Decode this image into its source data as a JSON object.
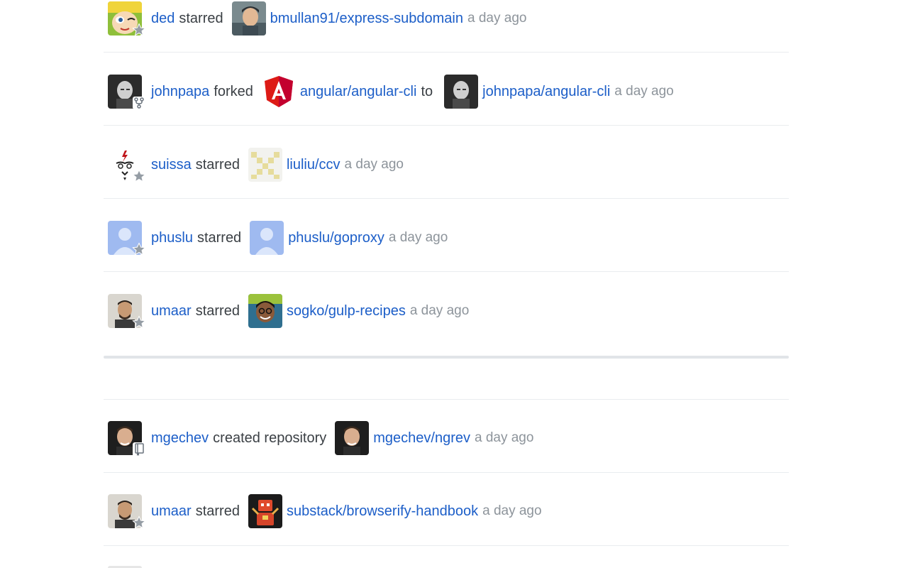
{
  "feed": {
    "events": [
      {
        "actor": "ded",
        "action": "starred",
        "repo": "bmullan91/express-subdomain",
        "time": "a day ago",
        "badge": "star-icon"
      },
      {
        "actor": "johnpapa",
        "action": "forked",
        "repo": "angular/angular-cli",
        "connector": "to",
        "target": "johnpapa/angular-cli",
        "time": "a day ago",
        "badge": "fork-icon"
      },
      {
        "actor": "suissa",
        "action": "starred",
        "repo": "liuliu/ccv",
        "time": "a day ago",
        "badge": "star-icon"
      },
      {
        "actor": "phuslu",
        "action": "starred",
        "repo": "phuslu/goproxy",
        "time": "a day ago",
        "badge": "star-icon"
      },
      {
        "actor": "umaar",
        "action": "starred",
        "repo": "sogko/gulp-recipes",
        "time": "a day ago",
        "badge": "star-icon"
      },
      {
        "actor": "mgechev",
        "action": "created repository",
        "repo": "mgechev/ngrev",
        "time": "a day ago",
        "badge": "repo-icon"
      },
      {
        "actor": "umaar",
        "action": "starred",
        "repo": "substack/browserify-handbook",
        "time": "a day ago",
        "badge": "star-icon"
      }
    ]
  },
  "colors": {
    "link": "#1c5ec8",
    "text": "#3a3f44",
    "muted": "#8d949b",
    "divider": "#e9ecef",
    "section_divider": "#e1e4e8"
  }
}
